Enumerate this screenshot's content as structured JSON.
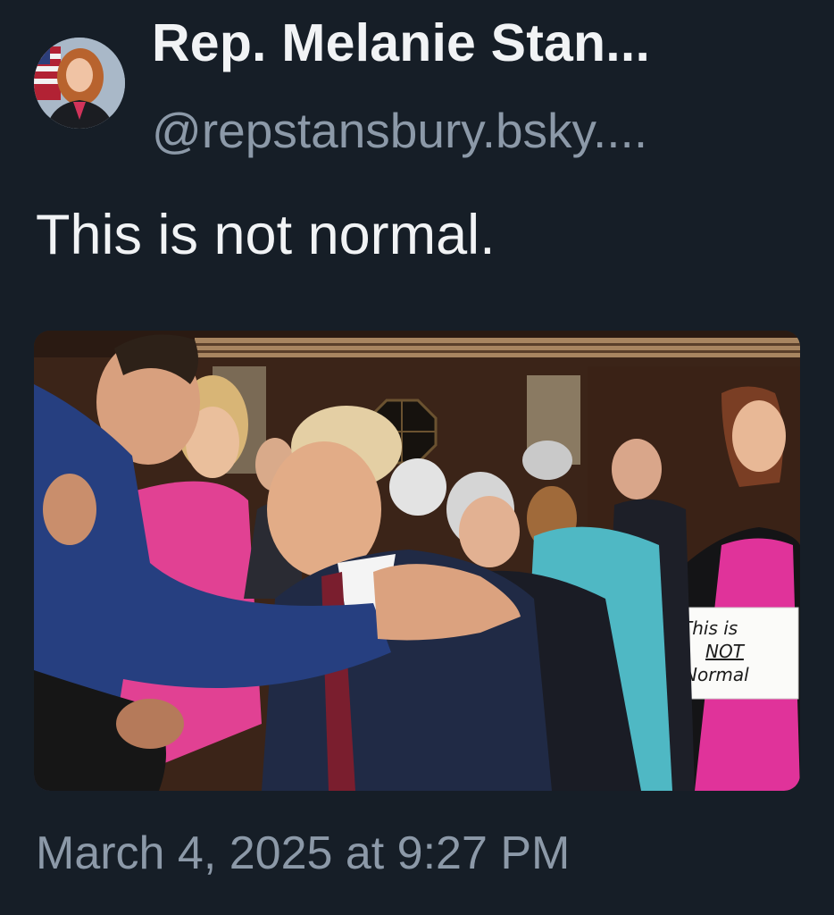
{
  "post": {
    "author": {
      "display_name": "Rep. Melanie Stan...",
      "handle": "@repstansbury.bsky...."
    },
    "text": "This is not normal.",
    "image": {
      "sign_lines": [
        "This is",
        "NOT",
        "Normal"
      ]
    },
    "timestamp": "March 4, 2025 at 9:27 PM"
  },
  "colors": {
    "background": "#161e27",
    "primary_text": "#f1f3f5",
    "secondary_text": "#8c99a8"
  }
}
